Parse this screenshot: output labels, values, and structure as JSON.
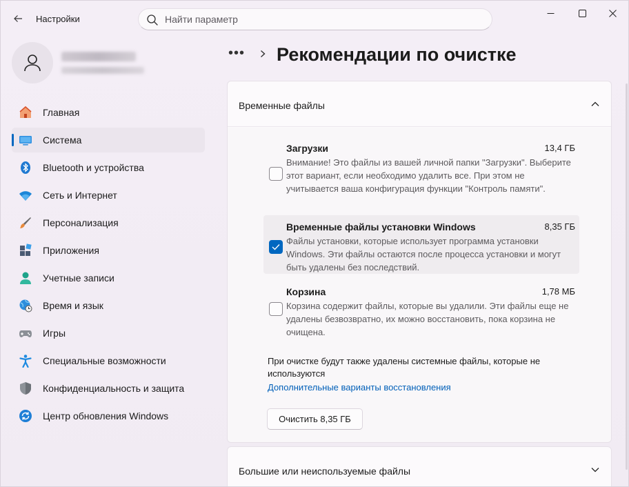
{
  "app": {
    "title": "Настройки"
  },
  "search": {
    "placeholder": "Найти параметр"
  },
  "sidebar": {
    "items": [
      {
        "label": "Главная",
        "icon": "home-icon"
      },
      {
        "label": "Система",
        "icon": "system-icon",
        "active": true
      },
      {
        "label": "Bluetooth и устройства",
        "icon": "bluetooth-icon"
      },
      {
        "label": "Сеть и Интернет",
        "icon": "wifi-icon"
      },
      {
        "label": "Персонализация",
        "icon": "brush-icon"
      },
      {
        "label": "Приложения",
        "icon": "apps-icon"
      },
      {
        "label": "Учетные записи",
        "icon": "account-icon"
      },
      {
        "label": "Время и язык",
        "icon": "globe-clock-icon"
      },
      {
        "label": "Игры",
        "icon": "gamepad-icon"
      },
      {
        "label": "Специальные возможности",
        "icon": "accessibility-icon"
      },
      {
        "label": "Конфиденциальность и защита",
        "icon": "shield-icon"
      },
      {
        "label": "Центр обновления Windows",
        "icon": "update-icon"
      }
    ]
  },
  "breadcrumb": {
    "more": "•••",
    "title": "Рекомендации по очистке"
  },
  "temp_section": {
    "title": "Временные файлы",
    "items": [
      {
        "title": "Загрузки",
        "size": "13,4 ГБ",
        "checked": false,
        "desc": "Внимание! Это файлы из вашей личной папки \"Загрузки\". Выберите этот вариант, если необходимо удалить все. При этом не учитывается ваша конфигурация функции \"Контроль памяти\"."
      },
      {
        "title": "Временные файлы установки Windows",
        "size": "8,35 ГБ",
        "checked": true,
        "desc": "Файлы установки, которые использует программа установки Windows.  Эти файлы остаются после процесса установки и могут быть удалены без последствий."
      },
      {
        "title": "Корзина",
        "size": "1,78 МБ",
        "checked": false,
        "desc": "Корзина содержит файлы, которые вы удалили. Эти файлы еще не удалены безвозвратно, их можно восстановить, пока корзина не очищена."
      }
    ],
    "note": "При очистке будут также удалены системные файлы, которые не используются",
    "link": "Дополнительные варианты восстановления",
    "clean_button": "Очистить 8,35 ГБ"
  },
  "large_section": {
    "title": "Большие или неиспользуемые файлы"
  },
  "colors": {
    "accent": "#0067c0",
    "link": "#005fb8"
  }
}
